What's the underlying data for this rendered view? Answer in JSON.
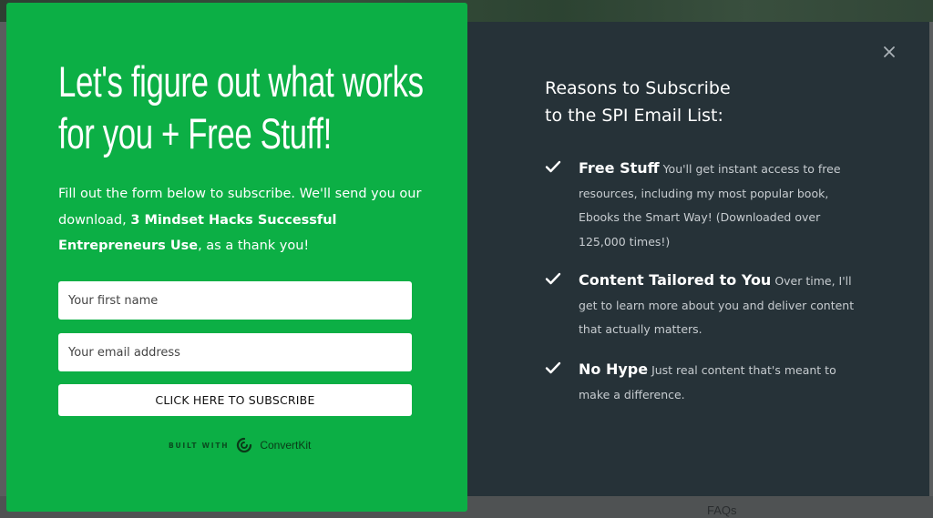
{
  "modal": {
    "headline": "Let's figure out what works for you + Free Stuff!",
    "intro_start": "Fill out the form below to subscribe. We'll send you our download, ",
    "intro_bold": "3 Mindset Hacks Successful Entrepreneurs Use",
    "intro_end": ", as a thank you!",
    "first_name_placeholder": "Your first name",
    "email_placeholder": "Your email address",
    "submit_label": "CLICK HERE TO SUBSCRIBE",
    "built_with": "BUILT WITH",
    "brand": "ConvertKit",
    "close_icon": "close-icon",
    "reasons_title_line1": "Reasons to Subscribe",
    "reasons_title_line2": "to the SPI Email List:",
    "reasons": [
      {
        "title": "Free Stuff",
        "text": "You'll get instant access to free resources, including my most popular book, Ebooks the Smart Way! (Downloaded over 125,000 times!)",
        "icon": "checkmark-icon"
      },
      {
        "title": "Content Tailored to You",
        "text": "Over time, I'll get to learn more about you and deliver content that actually matters.",
        "icon": "checkmark-icon"
      },
      {
        "title": "No Hype",
        "text": "Just real content that's meant to make a difference.",
        "icon": "checkmark-icon"
      }
    ]
  },
  "background": {
    "footer_link": "FAQs"
  },
  "colors": {
    "green_panel": "#0caf45",
    "dark_panel": "#263238",
    "overlay": "#5a5d5e"
  }
}
